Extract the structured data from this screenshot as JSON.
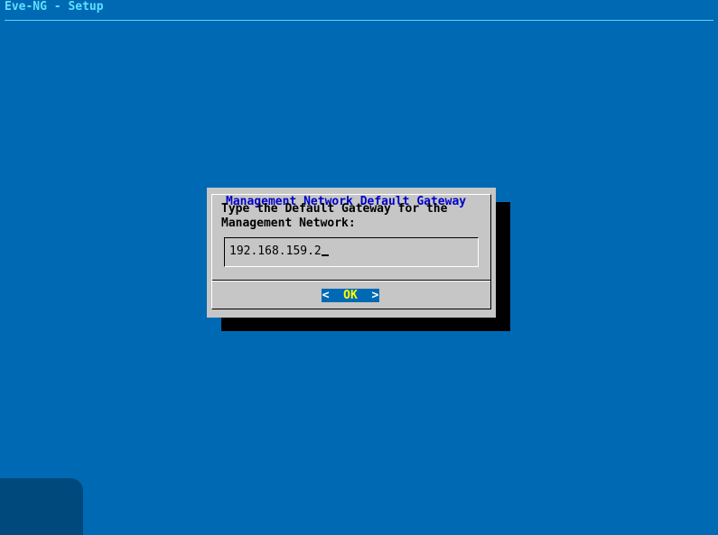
{
  "window": {
    "title": "Eve-NG - Setup"
  },
  "dialog": {
    "title": "Management Network Default Gateway",
    "prompt_line1": "Type the Default Gateway for the",
    "prompt_line2": "Management Network:",
    "input_value": "192.168.159.2",
    "ok_left": "<",
    "ok_label": "OK",
    "ok_right": ">"
  },
  "colors": {
    "background": "#0069b4",
    "title_text": "#5fe0ff",
    "dialog_bg": "#c6c6c6",
    "dialog_title": "#0000c8",
    "button_bg": "#0069b4",
    "button_label": "#ffff00"
  }
}
